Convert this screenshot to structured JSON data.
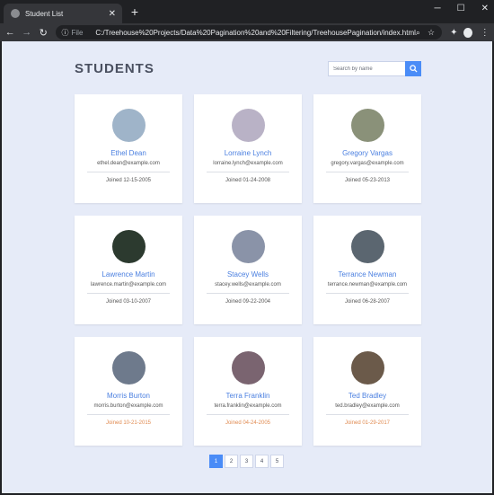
{
  "browser": {
    "tab_title": "Student List",
    "url_scheme": "File",
    "url": "C:/Treehouse%20Projects/Data%20Pagination%20and%20Filtering/TreehousePagination/index.html"
  },
  "page": {
    "title": "STUDENTS",
    "search_placeholder": "Search by name",
    "students": [
      {
        "name": "Ethel Dean",
        "email": "ethel.dean@example.com",
        "joined": "Joined 12-15-2005",
        "avatar_color": "#9fb4c9"
      },
      {
        "name": "Lorraine Lynch",
        "email": "lorraine.lynch@example.com",
        "joined": "Joined 01-24-2008",
        "avatar_color": "#b9b2c6"
      },
      {
        "name": "Gregory Vargas",
        "email": "gregory.vargas@example.com",
        "joined": "Joined 05-23-2013",
        "avatar_color": "#8a9179"
      },
      {
        "name": "Lawrence Martin",
        "email": "lawrence.martin@example.com",
        "joined": "Joined 03-10-2007",
        "avatar_color": "#2c3a2f"
      },
      {
        "name": "Stacey Wells",
        "email": "stacey.wells@example.com",
        "joined": "Joined 09-22-2004",
        "avatar_color": "#8a93a8"
      },
      {
        "name": "Terrance Newman",
        "email": "terrance.newman@example.com",
        "joined": "Joined 06-28-2007",
        "avatar_color": "#5b6670"
      },
      {
        "name": "Morris Burton",
        "email": "morris.burton@example.com",
        "joined": "Joined 10-21-2015",
        "avatar_color": "#6e7a8c",
        "joined_color": "orange"
      },
      {
        "name": "Terra Franklin",
        "email": "terra.franklin@example.com",
        "joined": "Joined 04-24-2005",
        "avatar_color": "#7a6470",
        "joined_color": "orange"
      },
      {
        "name": "Ted Bradley",
        "email": "ted.bradley@example.com",
        "joined": "Joined 01-29-2017",
        "avatar_color": "#6b5a4a",
        "joined_color": "orange"
      }
    ],
    "pages": [
      "1",
      "2",
      "3",
      "4",
      "5"
    ],
    "active_page": "1"
  },
  "colors": {
    "accent": "#4a8cf7",
    "name": "#4a7fe0",
    "background": "#e6ebf8"
  }
}
